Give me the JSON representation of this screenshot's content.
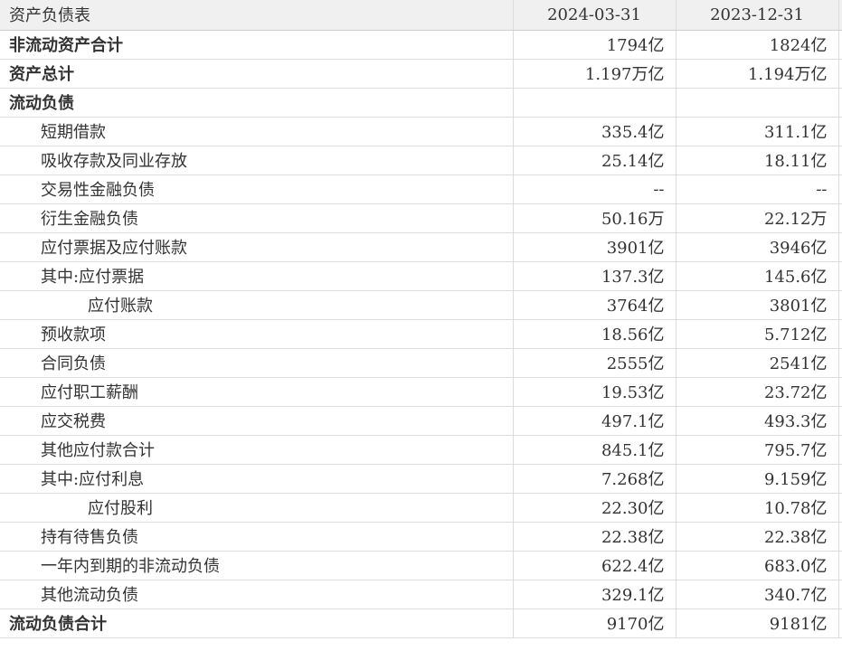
{
  "header": {
    "title": "资产负债表",
    "periods": [
      "2024-03-31",
      "2023-12-31"
    ]
  },
  "rows": [
    {
      "label": "非流动资产合计",
      "v1": "1794亿",
      "v2": "1824亿",
      "style": "bold"
    },
    {
      "label": "资产总计",
      "v1": "1.197万亿",
      "v2": "1.194万亿",
      "style": "bold"
    },
    {
      "label": "流动负债",
      "v1": "",
      "v2": "",
      "style": "bold"
    },
    {
      "label": "短期借款",
      "v1": "335.4亿",
      "v2": "311.1亿",
      "style": "l1"
    },
    {
      "label": "吸收存款及同业存放",
      "v1": "25.14亿",
      "v2": "18.11亿",
      "style": "l1"
    },
    {
      "label": "交易性金融负债",
      "v1": "--",
      "v2": "--",
      "style": "l1"
    },
    {
      "label": "衍生金融负债",
      "v1": "50.16万",
      "v2": "22.12万",
      "style": "l1"
    },
    {
      "label": "应付票据及应付账款",
      "v1": "3901亿",
      "v2": "3946亿",
      "style": "l1"
    },
    {
      "label": "其中:应付票据",
      "v1": "137.3亿",
      "v2": "145.6亿",
      "style": "l1"
    },
    {
      "label": "应付账款",
      "v1": "3764亿",
      "v2": "3801亿",
      "style": "l2"
    },
    {
      "label": "预收款项",
      "v1": "18.56亿",
      "v2": "5.712亿",
      "style": "l1"
    },
    {
      "label": "合同负债",
      "v1": "2555亿",
      "v2": "2541亿",
      "style": "l1"
    },
    {
      "label": "应付职工薪酬",
      "v1": "19.53亿",
      "v2": "23.72亿",
      "style": "l1"
    },
    {
      "label": "应交税费",
      "v1": "497.1亿",
      "v2": "493.3亿",
      "style": "l1"
    },
    {
      "label": "其他应付款合计",
      "v1": "845.1亿",
      "v2": "795.7亿",
      "style": "l1"
    },
    {
      "label": "其中:应付利息",
      "v1": "7.268亿",
      "v2": "9.159亿",
      "style": "l1"
    },
    {
      "label": "应付股利",
      "v1": "22.30亿",
      "v2": "10.78亿",
      "style": "l2"
    },
    {
      "label": "持有待售负债",
      "v1": "22.38亿",
      "v2": "22.38亿",
      "style": "l1"
    },
    {
      "label": "一年内到期的非流动负债",
      "v1": "622.4亿",
      "v2": "683.0亿",
      "style": "l1"
    },
    {
      "label": "其他流动负债",
      "v1": "329.1亿",
      "v2": "340.7亿",
      "style": "l1"
    },
    {
      "label": "流动负债合计",
      "v1": "9170亿",
      "v2": "9181亿",
      "style": "bold"
    }
  ]
}
